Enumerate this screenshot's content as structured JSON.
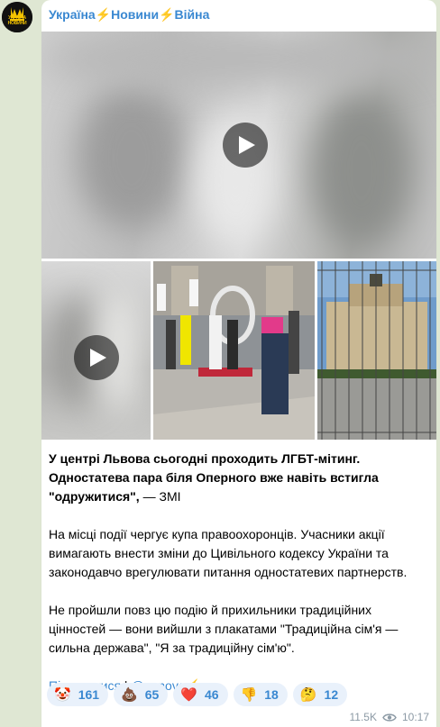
{
  "channel": {
    "name": "Україна⚡️Новини⚡️Війна",
    "avatar_text": "УКРАЇНА НОВИНИ"
  },
  "post": {
    "headline_bold": "У центрі Львова сьогодні проходить ЛГБТ-мітинг. Одностатева пара біля Оперного вже навіть встигла \"одружитися\",",
    "headline_tail": " — ЗМІ",
    "paragraph2": "На місці події чергує купа правоохоронців. Учасники акції вимагають внести зміни до Цивільного кодексу України та законодавчо врегулювати питання одностатевих партнерств.",
    "paragraph3": "Не пройшли повз цю подію й прихильники традиційних цінностей — вони вийшли з плакатами \"Традиційна сім'я — сильна держава\", \"Я за традиційну сім'ю\".",
    "subscribe_label": "Підписатися",
    "separator": " | ",
    "handle": "@uanova⚡️"
  },
  "reactions": [
    {
      "emoji": "🤡",
      "count": "161"
    },
    {
      "emoji": "💩",
      "count": "65"
    },
    {
      "emoji": "❤️",
      "count": "46"
    },
    {
      "emoji": "👎",
      "count": "18"
    },
    {
      "emoji": "🤔",
      "count": "12"
    }
  ],
  "meta": {
    "views": "11.5K",
    "time": "10:17"
  }
}
